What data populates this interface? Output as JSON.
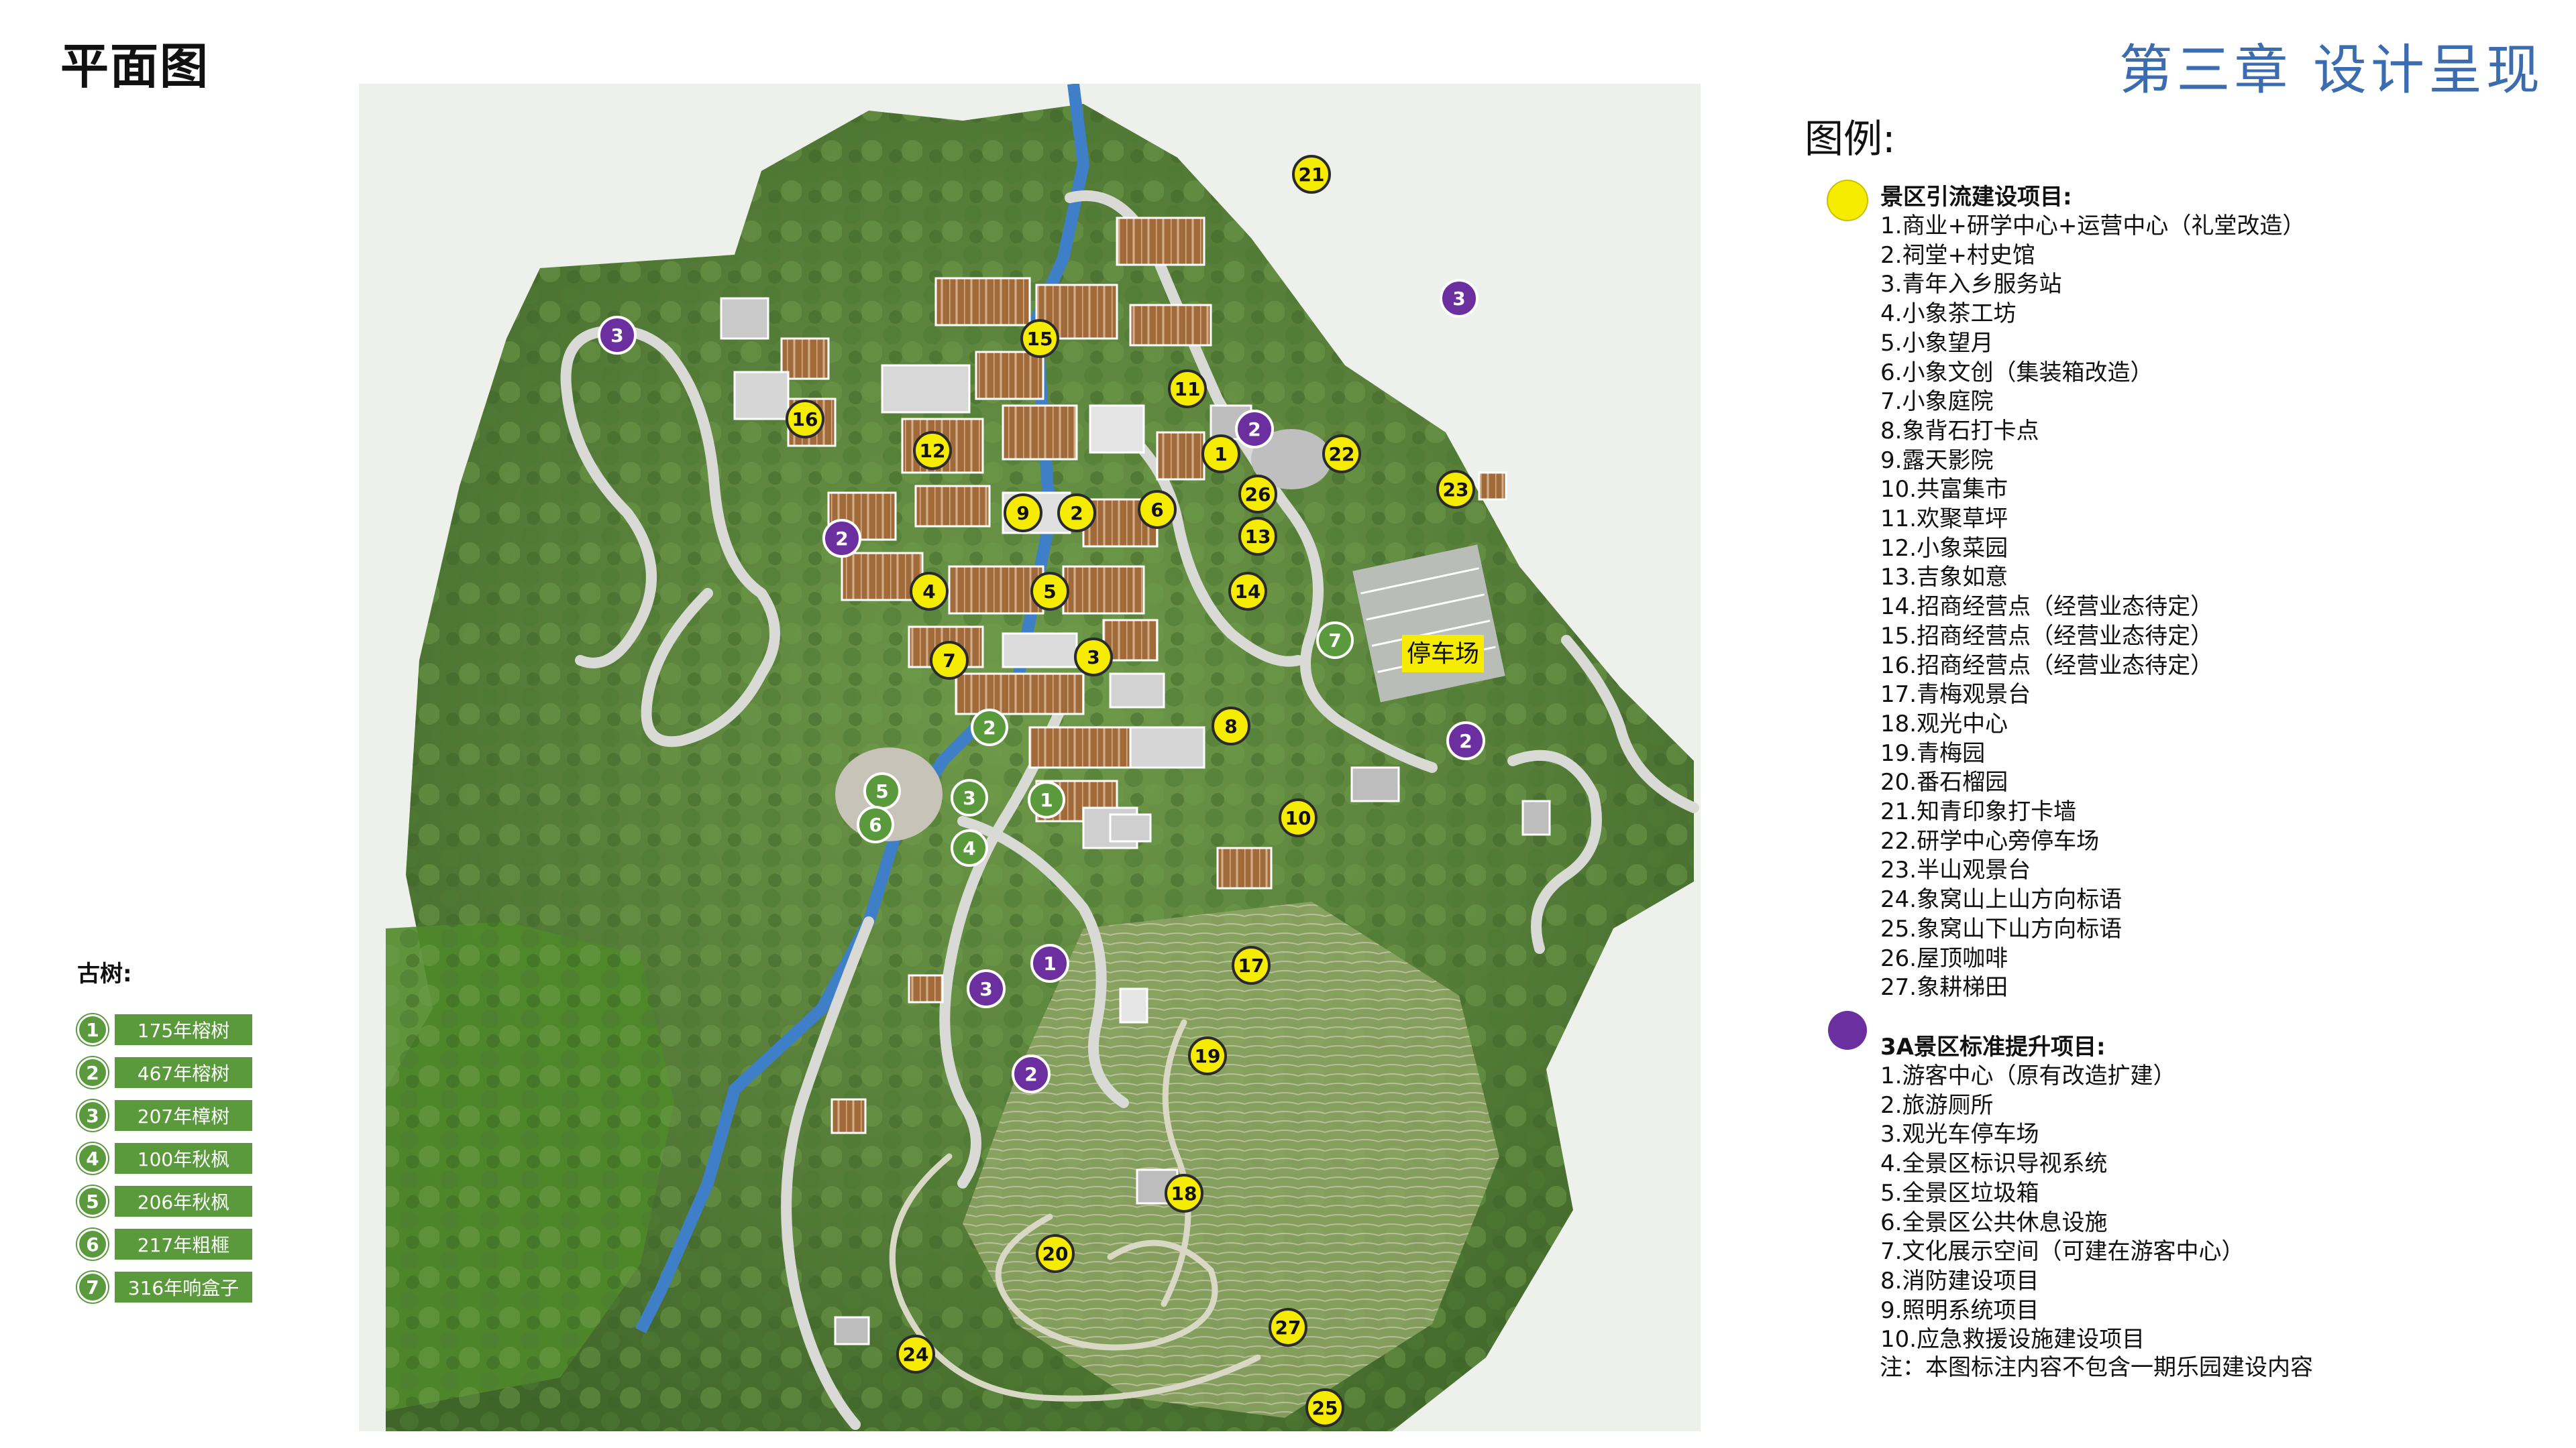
{
  "header": {
    "title": "平面图",
    "chapter": "第三章 设计呈现"
  },
  "colors": {
    "yellow": "#f5ec00",
    "purple": "#6b2fa0",
    "green": "#5a9a3c",
    "chapter_blue": "#3b6cb0",
    "parking_label_bg": "#f5ec00"
  },
  "map": {
    "parking_label": "停车场",
    "yellow_markers": [
      "21",
      "15",
      "11",
      "16",
      "12",
      "1",
      "22",
      "26",
      "23",
      "9",
      "2",
      "6",
      "13",
      "4",
      "5",
      "14",
      "7",
      "3",
      "8",
      "10",
      "17",
      "19",
      "18",
      "20",
      "27",
      "24",
      "25"
    ],
    "purple_markers": [
      "3",
      "3",
      "2",
      "2",
      "2",
      "1",
      "3",
      "2"
    ],
    "green_markers": [
      "7",
      "2",
      "5",
      "6",
      "3",
      "1",
      "4"
    ]
  },
  "trees": {
    "title": "古树:",
    "items": [
      {
        "num": "1",
        "label": "175年榕树"
      },
      {
        "num": "2",
        "label": "467年榕树"
      },
      {
        "num": "3",
        "label": "207年樟树"
      },
      {
        "num": "4",
        "label": "100年秋枫"
      },
      {
        "num": "5",
        "label": "206年秋枫"
      },
      {
        "num": "6",
        "label": "217年粗榧"
      },
      {
        "num": "7",
        "label": "316年响盒子"
      }
    ]
  },
  "legend": {
    "title": "图例:",
    "attraction": {
      "heading": "景区引流建设项目:",
      "items": [
        "1.商业+研学中心+运营中心（礼堂改造）",
        "2.祠堂+村史馆",
        "3.青年入乡服务站",
        "4.小象茶工坊",
        "5.小象望月",
        "6.小象文创（集装箱改造）",
        "7.小象庭院",
        "8.象背石打卡点",
        "9.露天影院",
        "10.共富集市",
        "11.欢聚草坪",
        "12.小象菜园",
        "13.吉象如意",
        "14.招商经营点（经营业态待定）",
        "15.招商经营点（经营业态待定）",
        "16.招商经营点（经营业态待定）",
        "17.青梅观景台",
        "18.观光中心",
        "19.青梅园",
        "20.番石榴园",
        "21.知青印象打卡墙",
        "22.研学中心旁停车场",
        "23.半山观景台",
        "24.象窝山上山方向标语",
        "25.象窝山下山方向标语",
        "26.屋顶咖啡",
        "27.象耕梯田"
      ]
    },
    "upgrade": {
      "heading": "3A景区标准提升项目:",
      "items": [
        "1.游客中心（原有改造扩建）",
        "2.旅游厕所",
        "3.观光车停车场",
        "4.全景区标识导视系统",
        "5.全景区垃圾箱",
        "6.全景区公共休息设施",
        "7.文化展示空间（可建在游客中心）",
        "8.消防建设项目",
        "9.照明系统项目",
        "10.应急救援设施建设项目"
      ]
    },
    "note": "注：本图标注内容不包含一期乐园建设内容"
  }
}
